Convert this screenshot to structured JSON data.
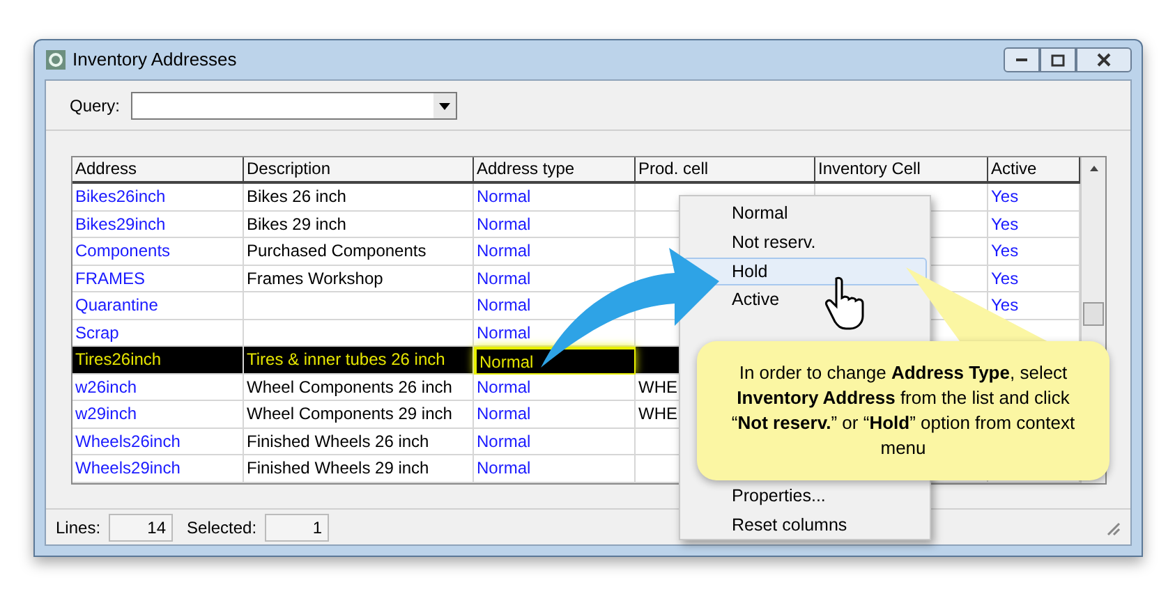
{
  "window": {
    "title": "Inventory Addresses"
  },
  "query": {
    "label": "Query:"
  },
  "table": {
    "columns": [
      "Address",
      "Description",
      "Address type",
      "Prod. cell",
      "Inventory Cell",
      "Active"
    ],
    "rows": [
      {
        "address": "Bikes26inch",
        "description": "Bikes 26 inch",
        "address_type": "Normal",
        "prod_cell": "",
        "active": "Yes",
        "selected": false
      },
      {
        "address": "Bikes29inch",
        "description": "Bikes 29 inch",
        "address_type": "Normal",
        "prod_cell": "",
        "active": "Yes",
        "selected": false
      },
      {
        "address": "Components",
        "description": "Purchased Components",
        "address_type": "Normal",
        "prod_cell": "",
        "active": "Yes",
        "selected": false
      },
      {
        "address": "FRAMES",
        "description": "Frames Workshop",
        "address_type": "Normal",
        "prod_cell": "",
        "active": "Yes",
        "selected": false
      },
      {
        "address": "Quarantine",
        "description": "",
        "address_type": "Normal",
        "prod_cell": "",
        "active": "Yes",
        "selected": false
      },
      {
        "address": "Scrap",
        "description": "",
        "address_type": "Normal",
        "prod_cell": "",
        "active": "",
        "selected": false
      },
      {
        "address": "Tires26inch",
        "description": "Tires & inner tubes 26 inch",
        "address_type": "Normal",
        "prod_cell": "",
        "active": "",
        "selected": true
      },
      {
        "address": "w26inch",
        "description": "Wheel Components 26 inch",
        "address_type": "Normal",
        "prod_cell": "WHE",
        "active": "",
        "selected": false
      },
      {
        "address": "w29inch",
        "description": "Wheel Components 29 inch",
        "address_type": "Normal",
        "prod_cell": "WHE",
        "active": "",
        "selected": false
      },
      {
        "address": "Wheels26inch",
        "description": "Finished Wheels 26 inch",
        "address_type": "Normal",
        "prod_cell": "",
        "active": "",
        "selected": false
      },
      {
        "address": "Wheels29inch",
        "description": "Finished Wheels 29 inch",
        "address_type": "Normal",
        "prod_cell": "",
        "active": "",
        "selected": false
      }
    ]
  },
  "status_bar": {
    "lines_label": "Lines:",
    "lines": "14",
    "selected_label": "Selected:",
    "selected": "1"
  },
  "context_menu": {
    "items": [
      {
        "label": "Normal",
        "selected": false
      },
      {
        "label": "Not reserv.",
        "selected": false
      },
      {
        "label": "Hold",
        "selected": true
      },
      {
        "label": "Active",
        "selected": false
      },
      {
        "label": "Properties...",
        "selected": false
      },
      {
        "label": "Reset columns",
        "selected": false
      }
    ]
  },
  "callout": {
    "text": "In order to change **Address Type**, select **Inventory Address** from the list and click “**Not reserv.**” or “**Hold**” option from context menu"
  }
}
